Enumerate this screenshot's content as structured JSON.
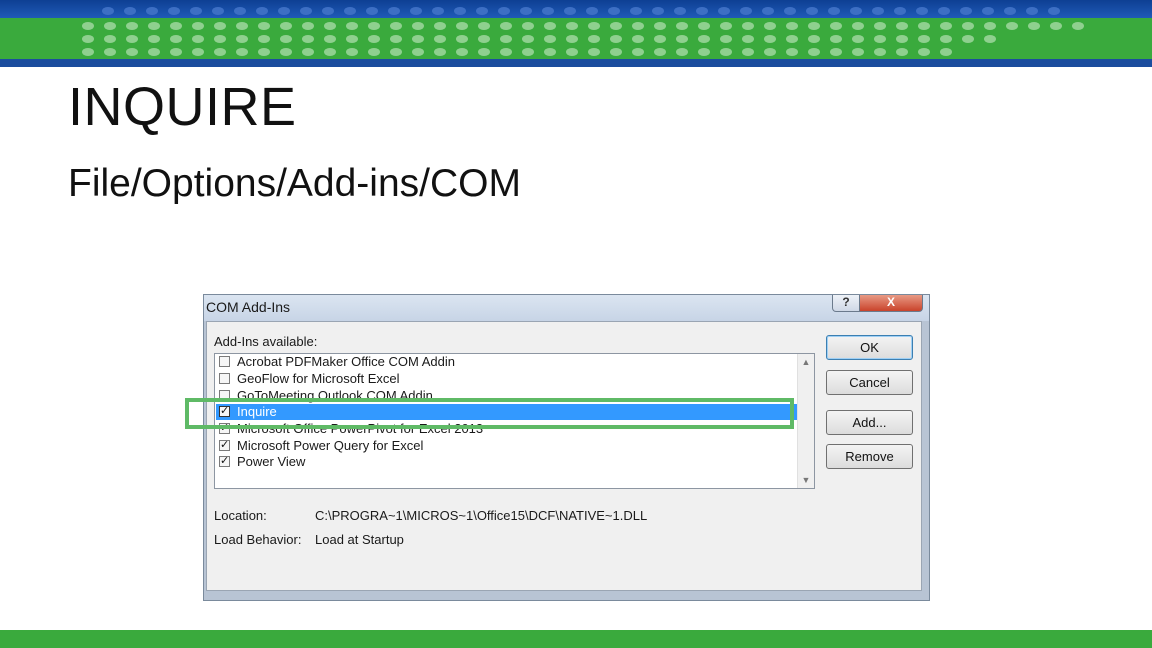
{
  "slide": {
    "title": "INQUIRE",
    "subtitle": "File/Options/Add-ins/COM"
  },
  "colors": {
    "header_blue": "#1b4d9e",
    "header_green": "#3aaa3d",
    "selection": "#3399ff",
    "highlight_frame": "#5fba66"
  },
  "dialog": {
    "title": "COM Add-Ins",
    "help_button": "?",
    "close_button": "X",
    "addins_label": "Add-Ins available:",
    "items": [
      {
        "label": "Acrobat PDFMaker Office COM Addin",
        "checked": false,
        "selected": false
      },
      {
        "label": "GeoFlow for Microsoft Excel",
        "checked": false,
        "selected": false
      },
      {
        "label": "GoToMeeting Outlook COM Addin",
        "checked": false,
        "selected": false
      },
      {
        "label": "Inquire",
        "checked": true,
        "selected": true
      },
      {
        "label": "Microsoft Office PowerPivot for Excel 2013",
        "checked": true,
        "selected": false
      },
      {
        "label": "Microsoft Power Query for Excel",
        "checked": true,
        "selected": false
      },
      {
        "label": "Power View",
        "checked": true,
        "selected": false
      }
    ],
    "buttons": {
      "ok": "OK",
      "cancel": "Cancel",
      "add": "Add...",
      "remove": "Remove"
    },
    "location_label": "Location:",
    "location_value": "C:\\PROGRA~1\\MICROS~1\\Office15\\DCF\\NATIVE~1.DLL",
    "load_behavior_label": "Load Behavior:",
    "load_behavior_value": "Load at Startup"
  }
}
